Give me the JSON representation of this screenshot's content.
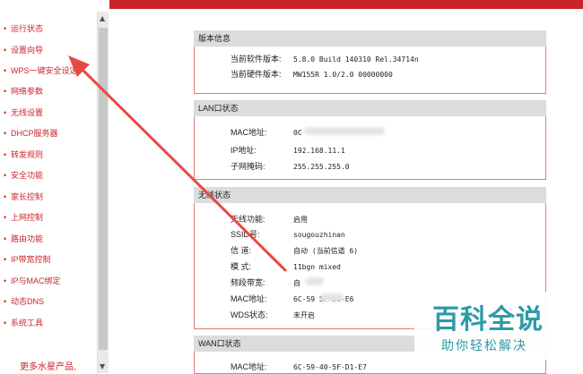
{
  "sidebar": {
    "items": [
      {
        "label": "运行状态"
      },
      {
        "label": "设置向导"
      },
      {
        "label": "WPS一键安全设定"
      },
      {
        "label": "网络参数"
      },
      {
        "label": "无线设置"
      },
      {
        "label": "DHCP服务器"
      },
      {
        "label": "转发规则"
      },
      {
        "label": "安全功能"
      },
      {
        "label": "家长控制"
      },
      {
        "label": "上网控制"
      },
      {
        "label": "路由功能"
      },
      {
        "label": "IP带宽控制"
      },
      {
        "label": "IP与MAC绑定"
      },
      {
        "label": "动态DNS"
      },
      {
        "label": "系统工具"
      }
    ],
    "bullet": "•",
    "more": "更多水星产品,"
  },
  "version": {
    "title": "版本信息",
    "software_label": "当前软件版本:",
    "software_value": "5.8.0 Build 140310 Rel.34714n",
    "hardware_label": "当前硬件版本:",
    "hardware_value": "MW155R 1.0/2.0 00000000"
  },
  "lan": {
    "title": "LAN口状态",
    "mac_label": "MAC地址:",
    "mac_value": "0C",
    "ip_label": "IP地址:",
    "ip_value": "192.168.11.1",
    "mask_label": "子网掩码:",
    "mask_value": "255.255.255.0"
  },
  "wireless": {
    "title": "无线状态",
    "func_label": "无线功能:",
    "func_value": "启用",
    "ssid_label": "SSID号:",
    "ssid_value": "sougouzhinan",
    "channel_label": "信 道:",
    "channel_value": "自动 (当前信道 6)",
    "mode_label": "模 式:",
    "mode_value": "11bgn mixed",
    "bandwidth_label": "频段带宽:",
    "bandwidth_value": "自",
    "mac_label": "MAC地址:",
    "mac_value": "6C-59      5F-D1-E6",
    "wds_label": "WDS状态:",
    "wds_value": "未开启"
  },
  "wan": {
    "title": "WAN口状态",
    "mac_label": "MAC地址:",
    "mac_value": "6C-59-40-5F-D1-E7"
  },
  "watermark": {
    "big": "百科全说",
    "small": "助你轻松解决"
  },
  "colors": {
    "accent_red": "#c9242b",
    "section_border": "#e07a7a",
    "watermark": "#2c9aa8"
  }
}
